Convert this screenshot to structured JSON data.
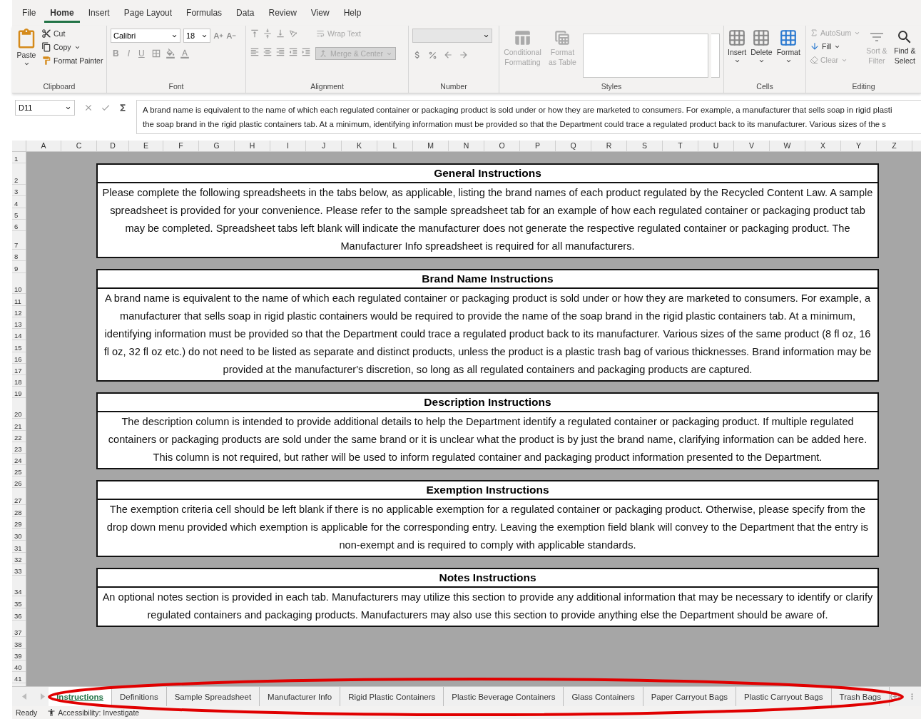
{
  "ribbon_tabs": [
    {
      "label": "File",
      "selected": false
    },
    {
      "label": "Home",
      "selected": true
    },
    {
      "label": "Insert",
      "selected": false
    },
    {
      "label": "Page Layout",
      "selected": false
    },
    {
      "label": "Formulas",
      "selected": false
    },
    {
      "label": "Data",
      "selected": false
    },
    {
      "label": "Review",
      "selected": false
    },
    {
      "label": "View",
      "selected": false
    },
    {
      "label": "Help",
      "selected": false
    }
  ],
  "clipboard": {
    "label": "Clipboard",
    "paste": "Paste",
    "cut": "Cut",
    "copy": "Copy",
    "format_painter": "Format Painter"
  },
  "font": {
    "label": "Font",
    "name": "Calibri",
    "size": "18",
    "bold": "B",
    "italic": "I",
    "underline": "U"
  },
  "alignment": {
    "label": "Alignment",
    "wrap_text": {
      "label": "Wrap Text",
      "disabled": true
    },
    "merge": {
      "label": "Merge & Center",
      "disabled": true
    }
  },
  "number": {
    "label": "Number"
  },
  "styles": {
    "label": "Styles",
    "conditional": {
      "label": "Conditional Formatting",
      "disabled": true
    },
    "format_table": {
      "label": "Format as Table",
      "disabled": true
    }
  },
  "cells": {
    "label": "Cells",
    "buttons": [
      {
        "label": "Insert"
      },
      {
        "label": "Delete"
      },
      {
        "label": "Format"
      }
    ]
  },
  "editing": {
    "label": "Editing",
    "autosum": {
      "label": "AutoSum",
      "disabled": true
    },
    "fill": {
      "label": "Fill",
      "disabled": false
    },
    "clear": {
      "label": "Clear",
      "disabled": true
    },
    "sort": {
      "label": "Sort & Filter",
      "disabled": true
    },
    "find": {
      "label": "Find & Select",
      "disabled": false
    }
  },
  "formula_bar": {
    "name_box": "D11",
    "lines": [
      "A brand name is equivalent to the name of which each regulated container or packaging product is sold under or how they are marketed to consumers. For example, a manufacturer that sells soap in rigid plasti",
      "the soap brand in the rigid plastic containers tab. At a minimum, identifying information must be provided so that the Department could trace a regulated product back to its manufacturer. Various sizes of the s"
    ]
  },
  "columns": [
    "A",
    "C",
    "D",
    "E",
    "F",
    "G",
    "H",
    "I",
    "J",
    "K",
    "L",
    "M",
    "N",
    "O",
    "P",
    "Q",
    "R",
    "S",
    "T",
    "U",
    "V",
    "W",
    "X",
    "Y",
    "Z"
  ],
  "rows": [
    "1",
    "2",
    "3",
    "4",
    "5",
    "6",
    "7",
    "8",
    "9",
    "10",
    "11",
    "12",
    "13",
    "14",
    "15",
    "16",
    "17",
    "18",
    "19",
    "20",
    "21",
    "22",
    "23",
    "24",
    "25",
    "26",
    "27",
    "28",
    "29",
    "30",
    "31",
    "32",
    "33",
    "34",
    "35",
    "36",
    "37",
    "38",
    "39",
    "40",
    "41"
  ],
  "sections": [
    {
      "title": "General Instructions",
      "text": "Please complete the following spreadsheets in the tabs below, as applicable, listing the brand names of each product regulated by the Recycled Content Law.  A sample spreadsheet is provided for your convenience. Please refer to the sample spreadsheet tab for an example of how each regulated container or packaging product tab may be completed. Spreadsheet tabs left blank will indicate the manufacturer does not generate the respective regulated container or packaging product. The Manufacturer Info spreadsheet is required for all manufacturers."
    },
    {
      "title": "Brand Name Instructions",
      "text": "A brand name is equivalent to the name of which each regulated container or packaging product is sold under or how they are marketed to consumers. For example, a manufacturer that sells soap in rigid plastic containers would be required to provide the name of the soap brand in the rigid plastic containers tab. At a minimum, identifying information must be provided so that the Department could trace a regulated product back to its manufacturer. Various sizes of the same product (8 fl oz, 16 fl oz, 32 fl oz etc.) do not need to be listed as separate and distinct products, unless the product is a plastic trash bag of various thicknesses. Brand information may be provided at the manufacturer's discretion, so long as all regulated containers and packaging products are captured."
    },
    {
      "title": "Description Instructions",
      "text": "The description column is intended to provide additional details to help the Department identify a regulated container or packaging product. If multiple regulated containers or packaging products are sold under the same brand or it is unclear what the product is by just the brand name, clarifying information can be added here. This column is not required, but rather will be used to inform regulated container and packaging product information presented to the Department."
    },
    {
      "title": "Exemption Instructions",
      "text": "The exemption criteria cell should be left blank if there is no applicable exemption for a regulated container or packaging product. Otherwise, please specify from the drop down menu provided which exemption is applicable for the corresponding entry. Leaving the exemption field blank will convey to the Department that the entry is non-exempt and is required to comply with applicable standards."
    },
    {
      "title": "Notes Instructions",
      "text": "An optional notes section is provided in each tab. Manufacturers may utilize this section to provide any additional information that may be necessary to identify or clarify regulated containers and packaging products. Manufacturers may also use this section to provide anything else the Department should be aware of."
    }
  ],
  "sheet_tabs": [
    {
      "label": "Instructions",
      "selected": true
    },
    {
      "label": "Definitions",
      "selected": false
    },
    {
      "label": "Sample Spreadsheet",
      "selected": false
    },
    {
      "label": "Manufacturer Info",
      "selected": false
    },
    {
      "label": "Rigid Plastic Containers",
      "selected": false
    },
    {
      "label": "Plastic Beverage Containers",
      "selected": false
    },
    {
      "label": "Glass Containers",
      "selected": false
    },
    {
      "label": "Paper Carryout Bags",
      "selected": false
    },
    {
      "label": "Plastic Carryout Bags",
      "selected": false
    },
    {
      "label": "Trash Bags",
      "selected": false
    }
  ],
  "status_bar": {
    "mode": "Ready",
    "accessibility": "Accessibility: Investigate"
  }
}
